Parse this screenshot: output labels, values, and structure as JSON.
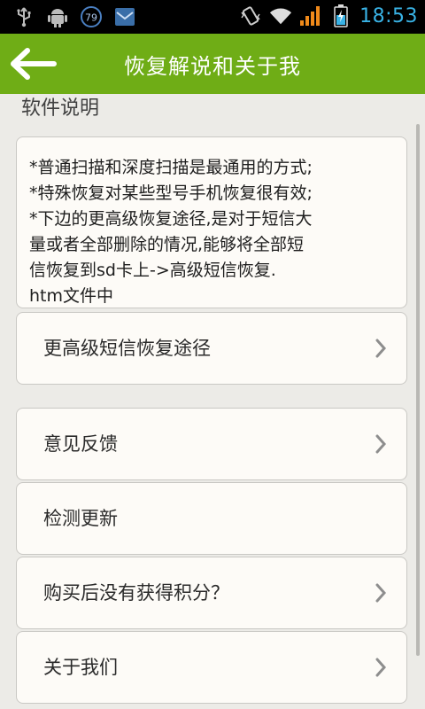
{
  "status_bar": {
    "notification_badge": "79",
    "time": "18:53",
    "icons": [
      "usb-icon",
      "android-debug-icon",
      "notification-79-icon",
      "mail-icon",
      "vibrate-icon",
      "wifi-icon",
      "signal-icon",
      "battery-icon"
    ]
  },
  "header": {
    "title": "恢复解说和关于我",
    "back_icon": "back-arrow-icon",
    "color": "#6fad16"
  },
  "section": {
    "heading": "软件说明"
  },
  "description": {
    "lines": [
      "*普通扫描和深度扫描是最通用的方式;",
      "*特殊恢复对某些型号手机恢复很有效;",
      "*下边的更高级恢复途径,是对于短信大",
      "量或者全部删除的情况,能够将全部短",
      "信恢复到sd卡上->高级短信恢复.",
      "htm文件中"
    ]
  },
  "menu": {
    "items": [
      {
        "label": "更高级短信恢复途径",
        "chevron": true
      },
      {
        "label": "意见反馈",
        "chevron": true
      },
      {
        "label": "检测更新",
        "chevron": false
      },
      {
        "label": "购买后没有获得积分？",
        "chevron": true
      },
      {
        "label": "关于我们",
        "chevron": true
      }
    ]
  }
}
